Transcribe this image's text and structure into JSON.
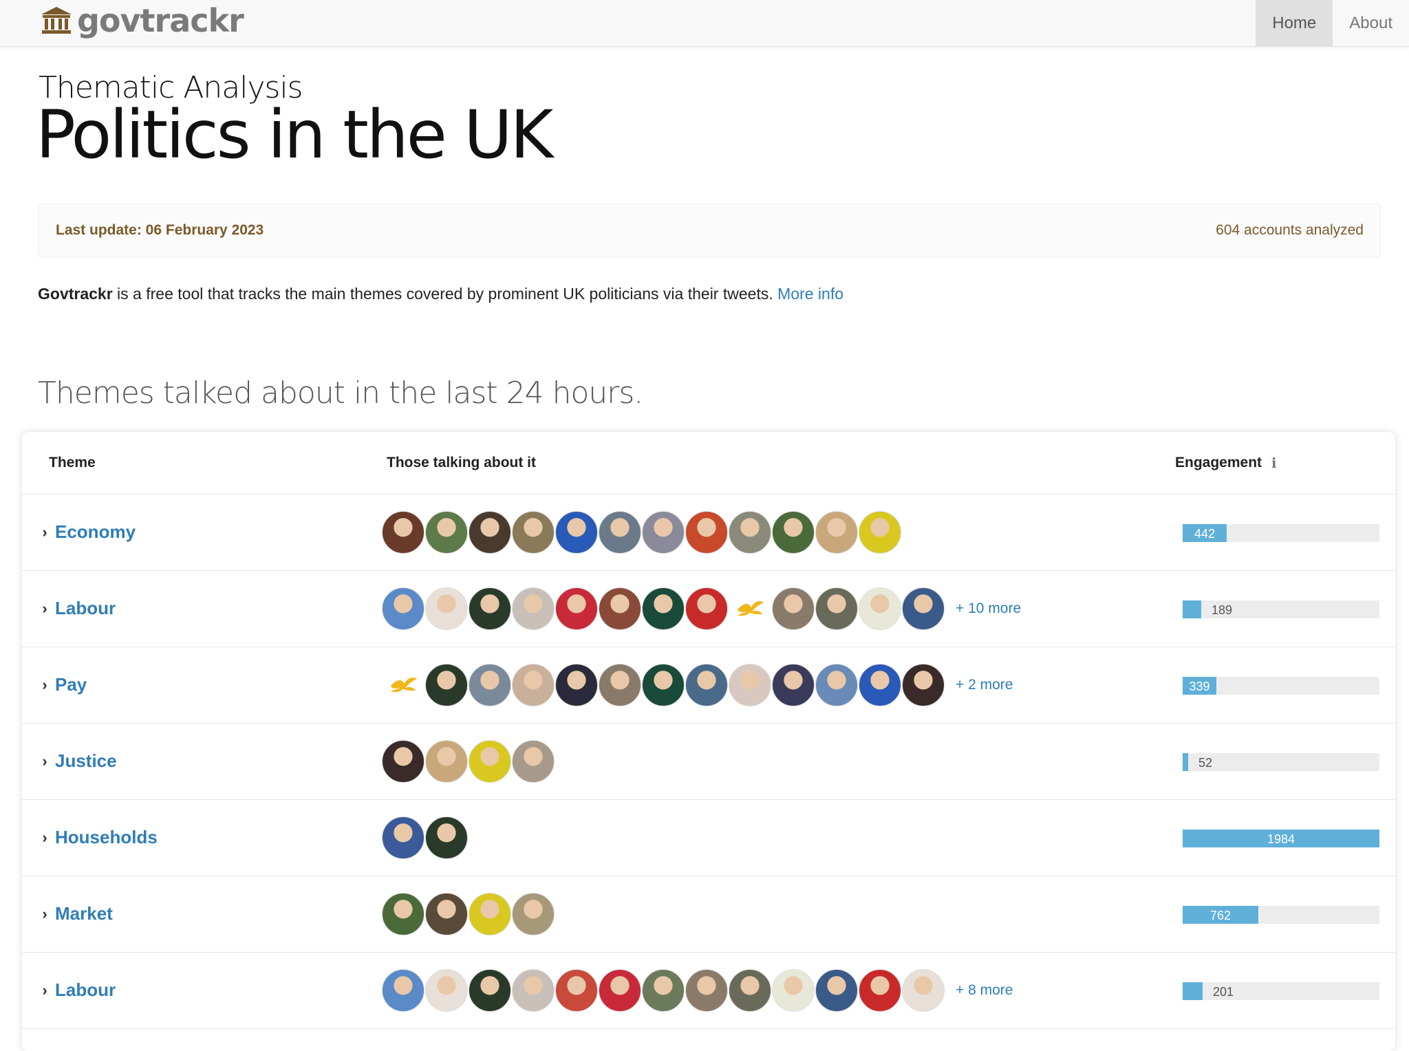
{
  "nav": {
    "brand": "govtrackr",
    "links": [
      {
        "label": "Home",
        "active": true
      },
      {
        "label": "About",
        "active": false
      }
    ]
  },
  "header": {
    "kicker": "Thematic Analysis",
    "title": "Politics in the UK"
  },
  "info": {
    "last_update": "Last update: 06 February 2023",
    "accounts": "604 accounts analyzed"
  },
  "intro": {
    "brand": "Govtrackr",
    "text": " is a free tool that tracks the main themes covered by prominent UK politicians via their tweets. ",
    "link": "More info"
  },
  "section_title": "Themes talked about in the last 24 hours.",
  "table": {
    "headers": {
      "theme": "Theme",
      "people": "Those talking about it",
      "engagement": "Engagement"
    },
    "max_engagement": 1984,
    "rows": [
      {
        "theme": "Economy",
        "engagement": 442,
        "more": "",
        "avatars": [
          "#6a3a2a",
          "#5d7a4a",
          "#4a3a2e",
          "#8a7a5a",
          "#2a5ab8",
          "#6a7a8a",
          "#8a8a9a",
          "#c84a2a",
          "#8a8a7a",
          "#4a6a3a",
          "#c8a87a",
          "#d8c820"
        ]
      },
      {
        "theme": "Labour",
        "engagement": 189,
        "more": "+ 10 more",
        "avatars": [
          "#5a8ac8",
          "#e8e0d8",
          "#2a3a2a",
          "#c8c0b8",
          "#c82a3a",
          "#8a4a3a",
          "#1a4a3a",
          "#c82a2a",
          "LOGO",
          "#8a7a6a",
          "#6a6a5a",
          "#e8e8d8",
          "#3a5a8a"
        ]
      },
      {
        "theme": "Pay",
        "engagement": 339,
        "more": "+ 2 more",
        "avatars": [
          "LOGO",
          "#2a3a2a",
          "#7a8a9a",
          "#c8b09a",
          "#2a2a3a",
          "#8a7a6a",
          "#1a4a3a",
          "#4a6a8a",
          "#d8c8c0",
          "#3a3a5a",
          "#6a8ab8",
          "#2a5ab8",
          "#3a2a2a"
        ]
      },
      {
        "theme": "Justice",
        "engagement": 52,
        "more": "",
        "avatars": [
          "#3a2a2a",
          "#c8a87a",
          "#d8c820",
          "#a89a8a"
        ]
      },
      {
        "theme": "Households",
        "engagement": 1984,
        "more": "",
        "avatars": [
          "#3a5a9a",
          "#2a3a2a"
        ]
      },
      {
        "theme": "Market",
        "engagement": 762,
        "more": "",
        "avatars": [
          "#4a6a3a",
          "#5a4a3a",
          "#d8c820",
          "#a8987a"
        ]
      },
      {
        "theme": "Labour",
        "engagement": 201,
        "more": "+ 8 more",
        "avatars": [
          "#5a8ac8",
          "#e8e0d8",
          "#2a3a2a",
          "#c8c0b8",
          "#c84a3a",
          "#c82a3a",
          "#6a7a5a",
          "#8a7a6a",
          "#6a6a5a",
          "#e8e8d8",
          "#3a5a8a",
          "#c82a2a",
          "#e8e0d8"
        ]
      }
    ]
  },
  "colors": {
    "link": "#2f7db8",
    "bar": "#5fb0d9",
    "bar_track": "#ececec",
    "info_text": "#7a5a2a"
  },
  "icons": {
    "brand": "bank-building-icon",
    "expand": "chevron-right-icon",
    "engagement_info": "info-icon",
    "party_logo": "lib-dem-bird-icon"
  }
}
